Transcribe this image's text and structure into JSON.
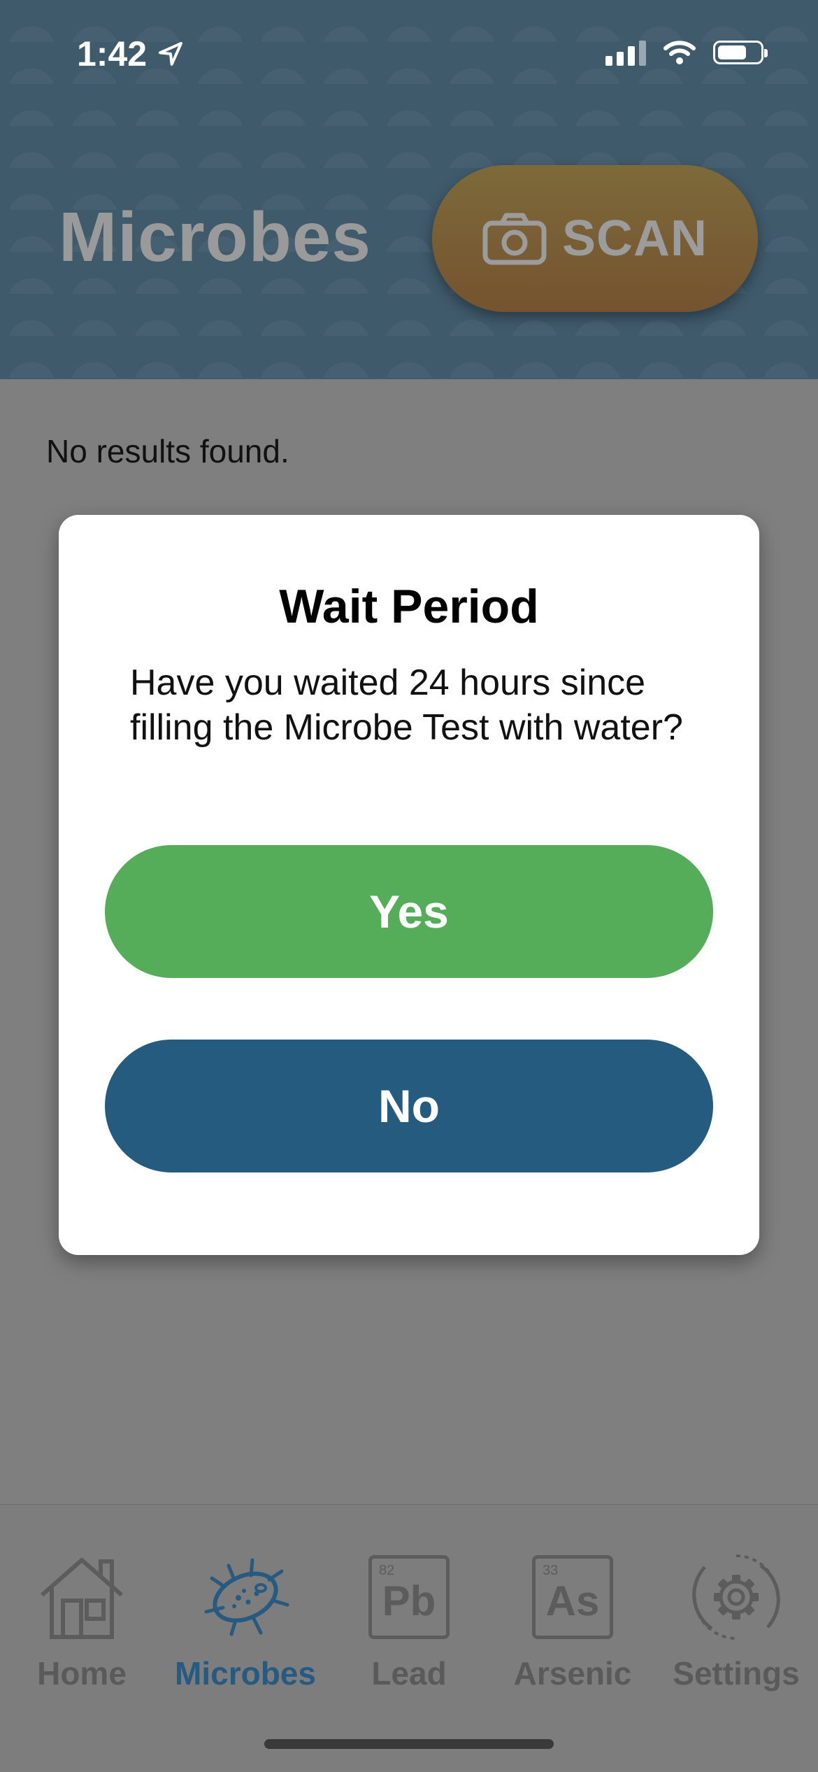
{
  "status_bar": {
    "time": "1:42"
  },
  "header": {
    "title": "Microbes",
    "scan_label": "SCAN"
  },
  "content": {
    "empty_message": "No results found."
  },
  "modal": {
    "title": "Wait Period",
    "message": "Have you waited 24 hours since filling the Microbe Test with water?",
    "yes_label": "Yes",
    "no_label": "No"
  },
  "tabs": [
    {
      "label": "Home",
      "icon": "house-icon"
    },
    {
      "label": "Microbes",
      "icon": "microbe-icon",
      "active": true
    },
    {
      "label": "Lead",
      "icon": "lead-element-icon",
      "symbol": "Pb",
      "number": "82"
    },
    {
      "label": "Arsenic",
      "icon": "arsenic-element-icon",
      "symbol": "As",
      "number": "33"
    },
    {
      "label": "Settings",
      "icon": "gear-icon"
    }
  ],
  "colors": {
    "header_bg": "#3f5a6b",
    "scan_button": "#7a5f35",
    "yes_button": "#55ad59",
    "no_button": "#265b80",
    "active_tab": "#275a80",
    "overlay_bg": "#7f7f7f"
  }
}
